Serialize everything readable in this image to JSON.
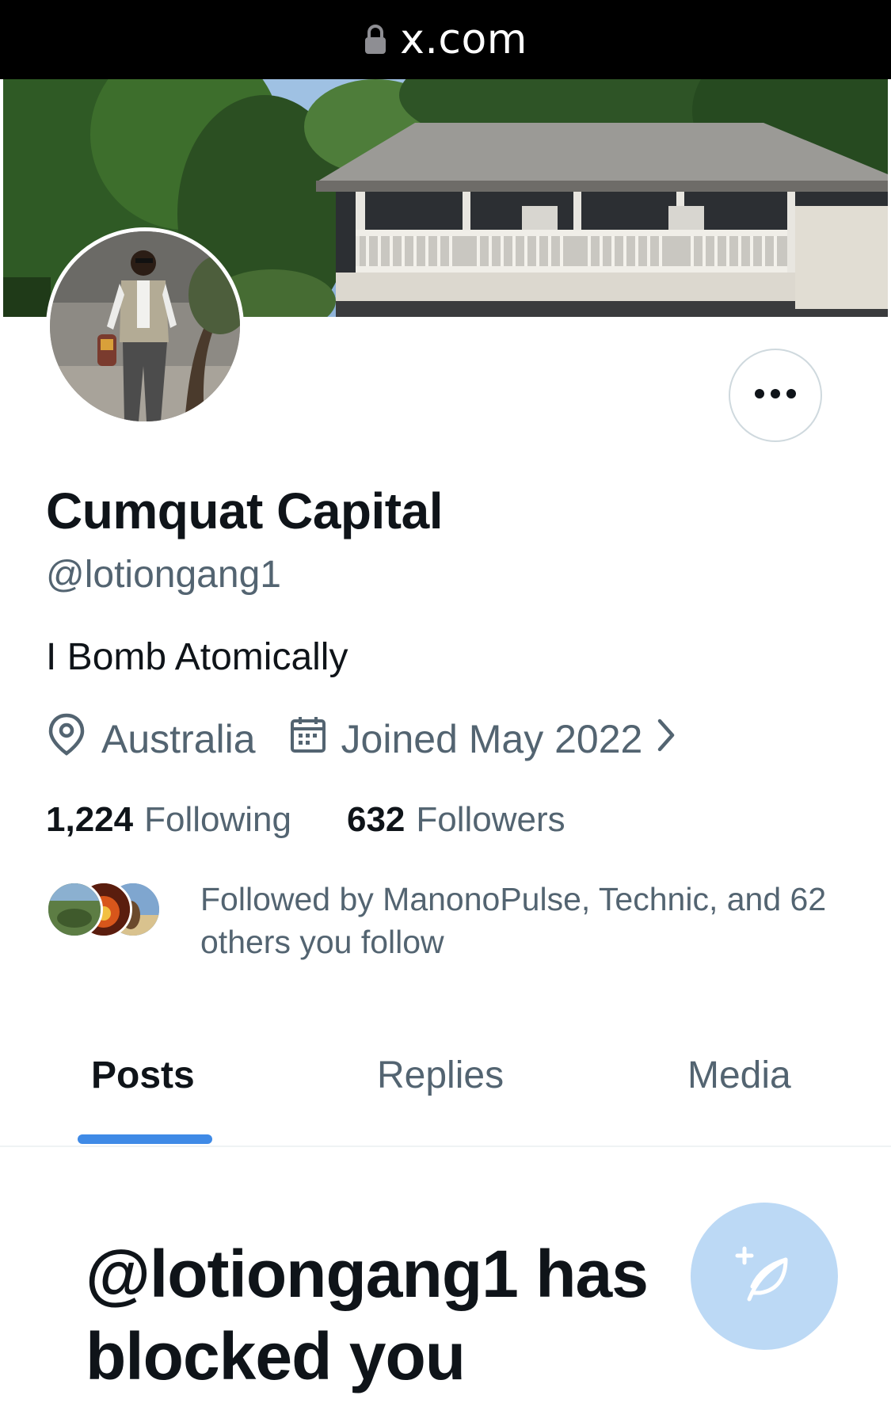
{
  "browser": {
    "url": "x.com",
    "lock_icon": "lock-icon"
  },
  "profile": {
    "name": "Cumquat Capital",
    "handle": "@lotiongang1",
    "bio": "I Bomb Atomically",
    "location": "Australia",
    "joined": "Joined May 2022",
    "following_count": "1,224",
    "following_label": "Following",
    "followers_count": "632",
    "followers_label": "Followers",
    "followed_by": "Followed by ManonoPulse, Technic, and 62 others you follow"
  },
  "icons": {
    "more": "more-icon",
    "location": "location-pin-icon",
    "calendar": "calendar-icon",
    "chevron": "chevron-right-icon",
    "compose": "compose-post-icon"
  },
  "tabs": [
    {
      "label": "Posts",
      "active": true
    },
    {
      "label": "Replies",
      "active": false
    },
    {
      "label": "Media",
      "active": false
    }
  ],
  "blocked_message": "@lotiongang1 has blocked you",
  "colors": {
    "accent": "#3f8ae6",
    "secondary_text": "#536471",
    "primary_text": "#0f1419",
    "fab": "#bcd9f5"
  }
}
